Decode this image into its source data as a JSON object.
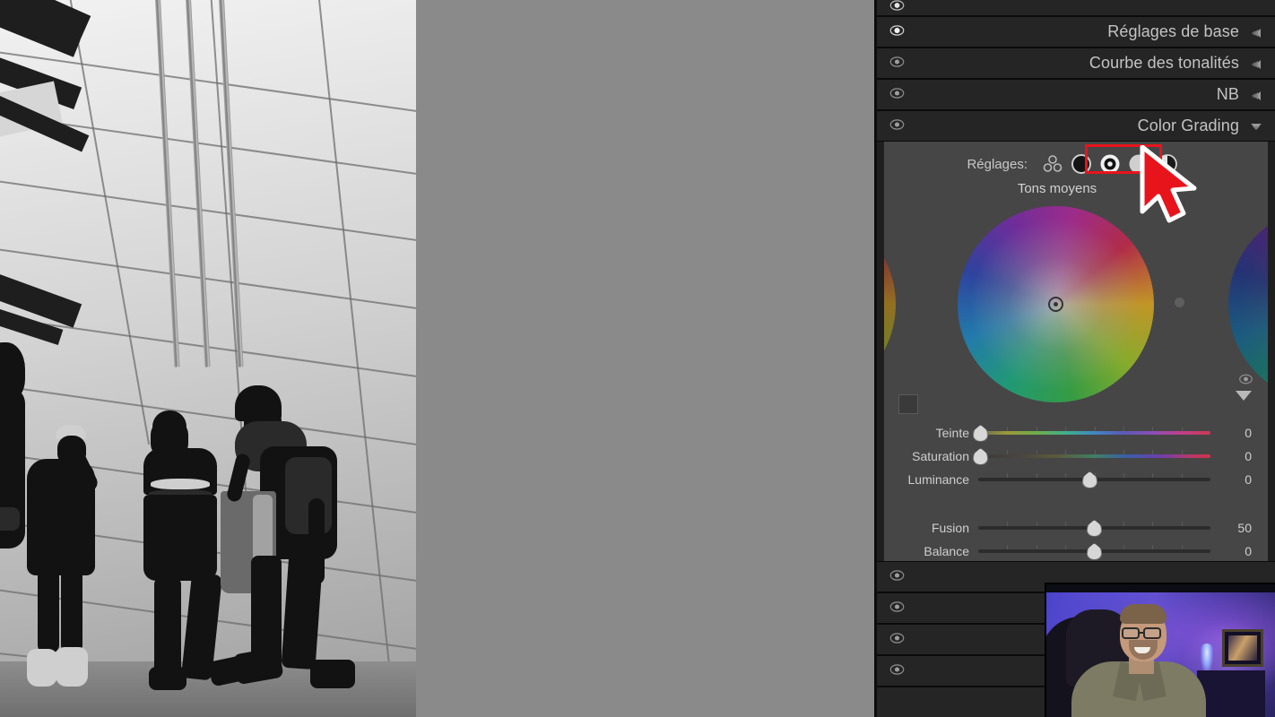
{
  "app": {
    "name": "Lightroom Develop Module",
    "locale": "fr"
  },
  "photo": {
    "alt_description": "Photo noir et blanc de trois enfants marchant devant une façade de bâtiment moderne",
    "treatment": "NB"
  },
  "right_panel": {
    "top_partial_row": {
      "label": "",
      "eye_icon": "eye-icon",
      "disc_icon": "collapse-disc-icon"
    },
    "panels": [
      {
        "label": "Réglages de base",
        "eye_icon": "eye-icon",
        "disc_icon": "collapse-disc-icon",
        "expanded": false
      },
      {
        "label": "Courbe des tonalités",
        "eye_icon": "eye-icon",
        "disc_icon": "collapse-disc-icon",
        "expanded": false
      },
      {
        "label": "NB",
        "eye_icon": "eye-icon",
        "disc_icon": "collapse-disc-icon",
        "expanded": false
      },
      {
        "label": "Color Grading",
        "eye_icon": "eye-icon",
        "disc_icon": "expand-disc-icon",
        "expanded": true
      }
    ],
    "bottom_panels": [
      {
        "label": "",
        "eye_icon": "eye-icon"
      },
      {
        "label": "",
        "eye_icon": "eye-icon"
      },
      {
        "label": "",
        "eye_icon": "eye-icon"
      },
      {
        "label": "",
        "eye_icon": "eye-icon"
      }
    ]
  },
  "color_grading": {
    "reglages_label": "Réglages:",
    "mode_buttons": [
      {
        "name": "three-wheels-icon",
        "title": "Trois roues",
        "selected": false
      },
      {
        "name": "shadows-circle-icon",
        "title": "Tons foncés",
        "selected": false
      },
      {
        "name": "midtones-circle-icon",
        "title": "Tons moyens",
        "selected": true
      },
      {
        "name": "highlights-circle-icon",
        "title": "Tons clairs",
        "selected": false
      },
      {
        "name": "global-half-circle-icon",
        "title": "Global",
        "selected": false
      }
    ],
    "selection_highlight_color": "#e8141c",
    "active_tone_label": "Tons moyens",
    "wheel": {
      "center_marker": "wheel-center-marker",
      "handle": "wheel-hue-handle",
      "swatch": "color-swatch",
      "eye_icon": "eye-icon",
      "triangle_icon": "triangle-down-icon"
    },
    "sliders": [
      {
        "label": "Teinte",
        "value": "0",
        "position_pct": 1,
        "track": "hue"
      },
      {
        "label": "Saturation",
        "value": "0",
        "position_pct": 1,
        "track": "sat"
      },
      {
        "label": "Luminance",
        "value": "0",
        "position_pct": 48,
        "track": "plain"
      }
    ],
    "global_sliders": [
      {
        "label": "Fusion",
        "value": "50",
        "position_pct": 50,
        "track": "plain"
      },
      {
        "label": "Balance",
        "value": "0",
        "position_pct": 50,
        "track": "plain"
      }
    ]
  },
  "overlay": {
    "webcam_label": "webcam-overlay",
    "cursor_label": "mouse-cursor",
    "cursor_color": "#e8141c"
  }
}
